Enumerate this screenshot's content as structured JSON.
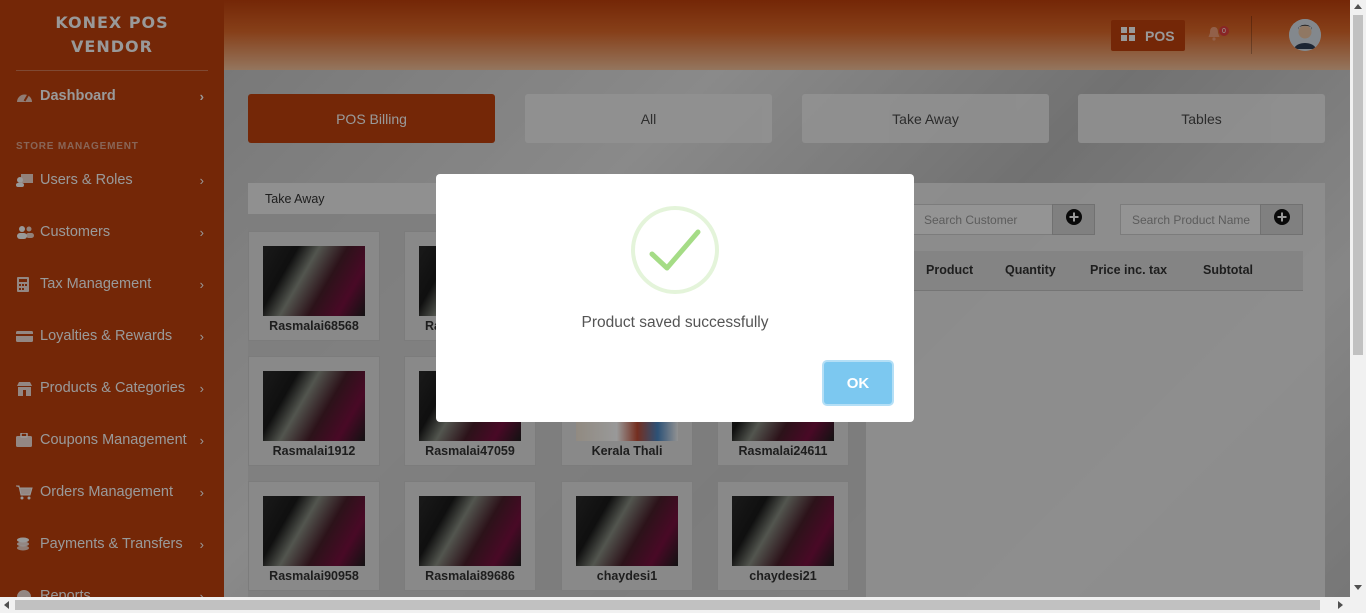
{
  "brand": {
    "line1": "KONEX POS",
    "line2": "VENDOR"
  },
  "sidebar": {
    "dashboard": "Dashboard",
    "section_label": "STORE MANAGEMENT",
    "items": [
      {
        "label": "Users & Roles",
        "icon": "users-roles-icon"
      },
      {
        "label": "Customers",
        "icon": "customers-icon"
      },
      {
        "label": "Tax Management",
        "icon": "calculator-icon"
      },
      {
        "label": "Loyalties & Rewards",
        "icon": "card-icon"
      },
      {
        "label": "Products & Categories",
        "icon": "store-icon"
      },
      {
        "label": "Coupons Management",
        "icon": "briefcase-icon"
      },
      {
        "label": "Orders Management",
        "icon": "cart-icon"
      },
      {
        "label": "Payments & Transfers",
        "icon": "coins-icon"
      },
      {
        "label": "Reports",
        "icon": "chart-icon"
      }
    ]
  },
  "header": {
    "pos_label": "POS",
    "notification_count": "0"
  },
  "tabs": [
    "POS Billing",
    "All",
    "Take Away",
    "Tables"
  ],
  "left_panel": {
    "order_type": "Take Away",
    "products": [
      "Rasmalai68568",
      "Ra",
      "",
      "",
      "Rasmalai1912",
      "Rasmalai47059",
      "Kerala Thali",
      "Rasmalai24611",
      "Rasmalai90958",
      "Rasmalai89686",
      "chaydesi1",
      "chaydesi21"
    ]
  },
  "right_panel": {
    "search_customer_placeholder": "Search Customer",
    "search_product_placeholder": "Search Product Name",
    "columns": [
      "Product",
      "Quantity",
      "Price inc. tax",
      "Subtotal"
    ]
  },
  "modal": {
    "message": "Product saved successfully",
    "ok_label": "OK"
  },
  "colors": {
    "brand": "#c2410c",
    "success": "#a5dc86",
    "ok_button": "#7cc8f0"
  }
}
